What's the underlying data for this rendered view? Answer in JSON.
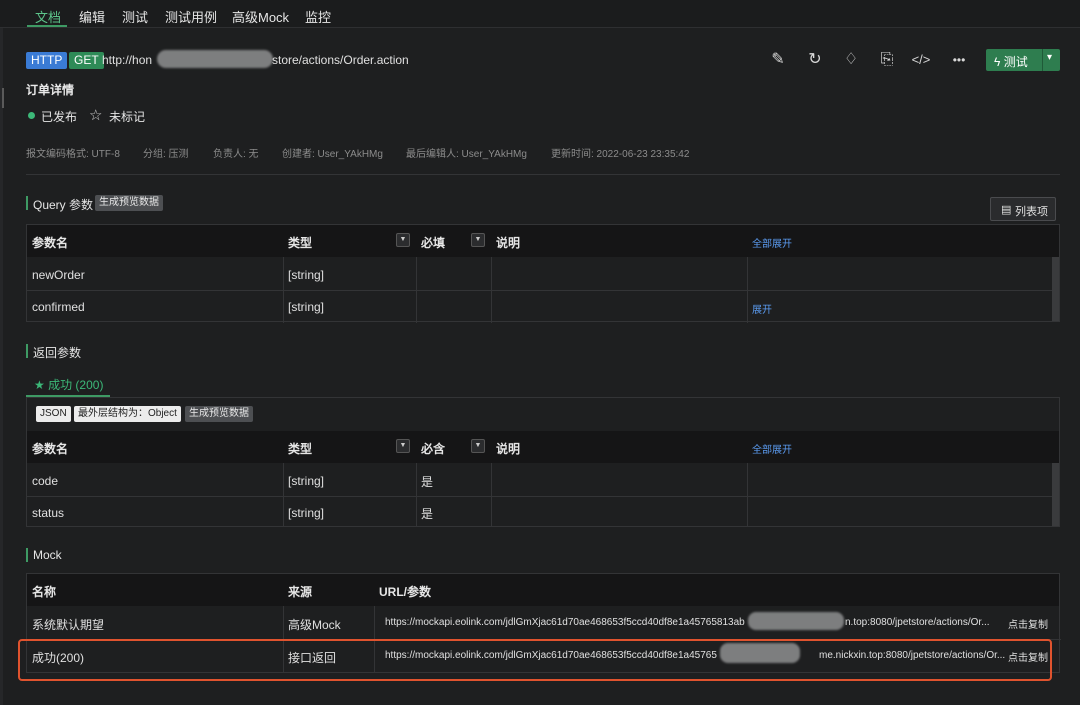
{
  "tabs": [
    "文档",
    "编辑",
    "测试",
    "测试用例",
    "高级Mock",
    "监控"
  ],
  "request": {
    "protocol": "HTTP",
    "method": "GET",
    "url_start": "http://hon",
    "url_end": "store/actions/Order.action"
  },
  "toolbar": {
    "edit_icon": "✎",
    "history_icon": "↻",
    "bell_icon": "♢",
    "share_icon": "⎘",
    "code_icon": "</>",
    "more_icon": "•••",
    "test_label": "测试",
    "test_icon": "ϟ",
    "caret": "▾"
  },
  "api_title": "订单详情",
  "status": "已发布",
  "marked": "未标记",
  "star_icon": "☆",
  "meta": {
    "encoding": "报文编码格式: UTF-8",
    "group": "分组: 压测",
    "owner": "负责人: 无",
    "creator": "创建者: User_YAkHMg",
    "editor": "最后编辑人: User_YAkHMg",
    "updated": "更新时间: 2022-06-23 23:35:42"
  },
  "query": {
    "title": "Query 参数",
    "generate": "生成预览数据",
    "list_btn": "列表项",
    "list_icon": "▤",
    "headers": [
      "参数名",
      "类型",
      "必填",
      "说明",
      "全部展开"
    ],
    "rows": [
      {
        "name": "newOrder",
        "type": "[string]",
        "required": "",
        "desc": "",
        "action": ""
      },
      {
        "name": "confirmed",
        "type": "[string]",
        "required": "",
        "desc": "",
        "action": "展开"
      }
    ]
  },
  "response": {
    "title": "返回参数",
    "success_tab": "★ 成功 (200)",
    "format": "JSON",
    "outer": "最外层结构为：Object",
    "generate": "生成预览数据",
    "headers": [
      "参数名",
      "类型",
      "必含",
      "说明",
      "全部展开"
    ],
    "rows": [
      {
        "name": "code",
        "type": "[string]",
        "required": "是"
      },
      {
        "name": "status",
        "type": "[string]",
        "required": "是"
      }
    ]
  },
  "mock": {
    "title": "Mock",
    "headers": [
      "名称",
      "来源",
      "URL/参数"
    ],
    "rows": [
      {
        "name": "系统默认期望",
        "source": "高级Mock",
        "url_a": "https://mockapi.eolink.com/jdlGmXjac61d70ae468653f5ccd40df8e1a45765813ab",
        "url_b": "n.top:8080/jpetstore/actions/Or...",
        "copy": "点击复制"
      },
      {
        "name": "成功(200)",
        "source": "接口返回",
        "url_a": "https://mockapi.eolink.com/jdlGmXjac61d70ae468653f5ccd40df8e1a45765",
        "url_b": "me.nickxin.top:8080/jpetstore/actions/Or...",
        "copy": "点击复制"
      }
    ]
  },
  "colors": {
    "accent": "#3e9a64",
    "link": "#5b9bf0",
    "highlight": "#e0532e",
    "http": "#3a7bd5",
    "get": "#2e8b57"
  }
}
